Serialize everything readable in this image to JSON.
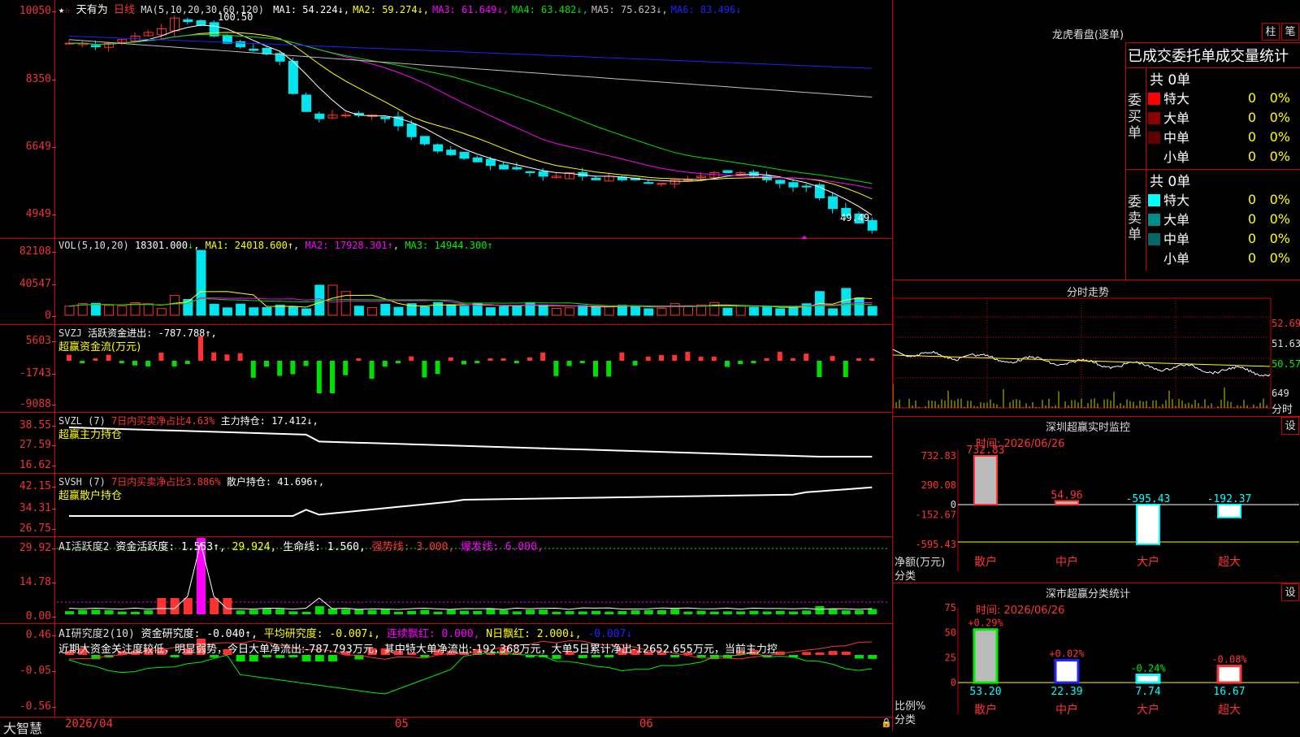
{
  "colors": {
    "up": "#ff3232",
    "down": "#00e5ee",
    "green": "#00e000",
    "yellow": "#ffff00",
    "magenta": "#ff00ff",
    "white": "#ffffff",
    "grid": "#c00000"
  },
  "main": {
    "name": "天有为",
    "period": "日线",
    "ma_prefix": "MA(5,10,20,30,60,120)",
    "ma": [
      {
        "label": "MA1:",
        "value": "54.224",
        "arrow": "↓",
        "color": "#ffffff"
      },
      {
        "label": "MA2:",
        "value": "59.274",
        "arrow": "↓",
        "color": "#ffff00"
      },
      {
        "label": "MA3:",
        "value": "61.649",
        "arrow": "↓",
        "color": "#ff00ff"
      },
      {
        "label": "MA4:",
        "value": "63.482",
        "arrow": "↓",
        "color": "#00e000"
      },
      {
        "label": "MA5:",
        "value": "75.623",
        "arrow": "↓",
        "color": "#c0c0c0"
      },
      {
        "label": "MA6:",
        "value": "83.496",
        "arrow": "↓",
        "color": "#2020ff"
      }
    ],
    "axis": [
      "10050",
      "8350",
      "6649",
      "4949"
    ],
    "high_label": "100.50",
    "low_label": "49.49"
  },
  "vol": {
    "title": "VOL(5,10,20)",
    "value": "18301.000",
    "arrow": "↓",
    "ma1": "MA1: 24018.600↑",
    "ma2": "MA2: 17928.301↑",
    "ma3": "MA3: 14944.300↑",
    "axis": [
      "82108",
      "40547",
      "0"
    ]
  },
  "svzj": {
    "title": "SVZJ",
    "label": "活跃资金进出:",
    "value": "-787.788↑,",
    "sub": "超赢资金流(万元)",
    "axis": [
      "5603",
      "-1743",
      "-9088"
    ]
  },
  "svzl": {
    "title": "SVZL (7)",
    "label": "7日内买卖净占比4.63%",
    "label2": "主力持仓: 17.412↓,",
    "sub": "超赢主力持仓",
    "axis": [
      "38.55",
      "27.59",
      "16.62"
    ]
  },
  "svsh": {
    "title": "SVSH (7)",
    "label": "7日内买卖净占比3.886%",
    "label2": "散户持仓: 41.696↑,",
    "sub": "超赢散户持仓",
    "axis": [
      "42.15",
      "34.31",
      "26.75"
    ]
  },
  "ai1": {
    "title": "AI活跃度2",
    "l1": "资金活跃度: 1.553↑,",
    "l2": "29.924,",
    "l3": "生命线: 1.560,",
    "l4": "强势线: 3.000,",
    "l5": "爆发线: 6.000,",
    "axis": [
      "29.92",
      "14.78",
      "0.00"
    ]
  },
  "ai2": {
    "title": "AI研究度2(10)",
    "l1": "资金研究度: -0.040↑,",
    "l2": "平均研究度: -0.007↓,",
    "l3": "连续飘红: 0.000,",
    "l4": "N日飘红: 2.000↓,",
    "l5": "-0.007↓",
    "desc": "近期大资金关注度较低，明显弱势，今日大单净流出:-787.793万元，其中特大单净流出:-192.368万元，大单5日累计净出-12652.655万元，当前主力控",
    "axis": [
      "0.46",
      "-0.05",
      "-0.56"
    ]
  },
  "dates": [
    "2026/04",
    "05",
    "06"
  ],
  "brand": "大智慧",
  "lhb": {
    "title": "龙虎看盘(逐单)",
    "btn1": "柱",
    "btn2": "笔",
    "header": "已成交委托单成交量统计",
    "buy": {
      "side": "委买单",
      "total": "共 0单",
      "rows": [
        {
          "label": "特大",
          "n": "0",
          "p": "0%",
          "color": "#ff0000"
        },
        {
          "label": "大单",
          "n": "0",
          "p": "0%",
          "color": "#8b0000"
        },
        {
          "label": "中单",
          "n": "0",
          "p": "0%",
          "color": "#600000"
        },
        {
          "label": "小单",
          "n": "0",
          "p": "0%",
          "color": "#000000"
        }
      ]
    },
    "sell": {
      "side": "委卖单",
      "total": "共 0单",
      "rows": [
        {
          "label": "特大",
          "n": "0",
          "p": "0%",
          "color": "#00ffff"
        },
        {
          "label": "大单",
          "n": "0",
          "p": "0%",
          "color": "#008b8b"
        },
        {
          "label": "中单",
          "n": "0",
          "p": "0%",
          "color": "#006666"
        },
        {
          "label": "小单",
          "n": "0",
          "p": "0%",
          "color": "#000000"
        }
      ]
    }
  },
  "fenshi": {
    "title": "分时走势",
    "axis": [
      "52.69",
      "51.63",
      "50.57",
      "649"
    ],
    "unit": "分时"
  },
  "sz_monitor": {
    "title": "深圳超赢实时监控",
    "btn": "设",
    "time": "时间: 2026/06/26",
    "axis": [
      "732.83",
      "290.08",
      "0",
      "-152.67",
      "-595.43"
    ],
    "ylabel": "净额(万元)",
    "xlabel": "分类",
    "cats": [
      "散户",
      "中户",
      "大户",
      "超大"
    ],
    "values": [
      732.83,
      54.96,
      -595.43,
      -192.37
    ],
    "labels": [
      "732.83",
      "54.96",
      "-595.43",
      "-192.37"
    ]
  },
  "sz_class": {
    "title": "深市超赢分类统计",
    "btn": "设",
    "time": "时间: 2026/06/26",
    "axis": [
      "75",
      "50",
      "25",
      "0"
    ],
    "ylabel": "比例%",
    "xlabel": "分类",
    "cats": [
      "散户",
      "中户",
      "大户",
      "超大"
    ],
    "values": [
      53.2,
      22.39,
      7.74,
      16.67
    ],
    "changes": [
      "+0.29%",
      "+0.02%",
      "-0.24%",
      "-0.08%"
    ],
    "labels": [
      "53.20",
      "22.39",
      "7.74",
      "16.67"
    ]
  }
}
